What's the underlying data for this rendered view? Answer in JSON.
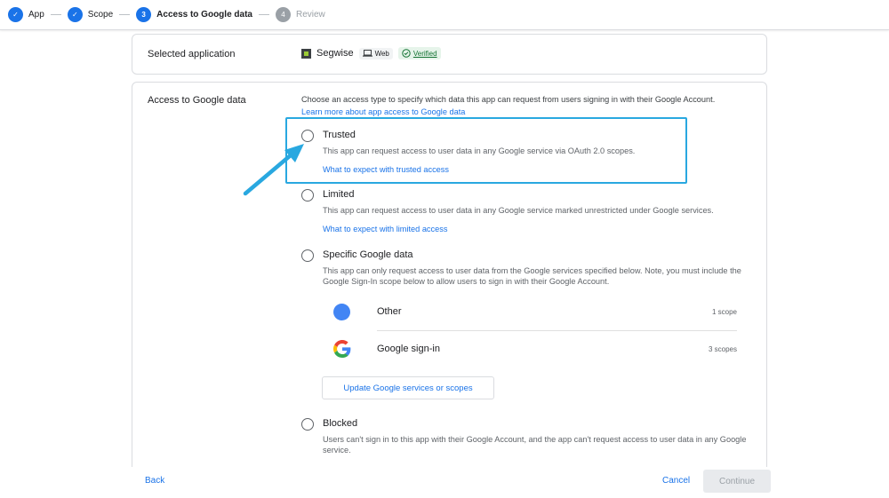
{
  "stepper": {
    "steps": [
      {
        "label": "App",
        "marker": "✓",
        "state": "done"
      },
      {
        "label": "Scope",
        "marker": "✓",
        "state": "done"
      },
      {
        "label": "Access to Google data",
        "marker": "3",
        "state": "current"
      },
      {
        "label": "Review",
        "marker": "4",
        "state": "pending"
      }
    ]
  },
  "selected_app": {
    "label": "Selected application",
    "app_name": "Segwise",
    "platform_chip": "Web",
    "verified_chip": "Verified"
  },
  "access": {
    "label": "Access to Google data",
    "intro": "Choose an access type to specify which data this app can request from users signing in with their Google Account.",
    "learn_more": "Learn more about app access to Google data",
    "options": {
      "trusted": {
        "title": "Trusted",
        "description": "This app can request access to user data in any Google service via OAuth 2.0 scopes.",
        "link": "What to expect with trusted access"
      },
      "limited": {
        "title": "Limited",
        "description": "This app can request access to user data in any Google service marked unrestricted under Google services.",
        "link": "What to expect with limited access"
      },
      "specific": {
        "title": "Specific Google data",
        "description": "This app can only request access to user data from the Google services specified below. Note, you must include the Google Sign-In scope below to allow users to sign in with their Google Account."
      },
      "blocked": {
        "title": "Blocked",
        "description": "Users can't sign in to this app with their Google Account, and the app can't request access to user data in any Google service."
      }
    },
    "services": [
      {
        "name": "Other",
        "count": "1 scope",
        "icon": "blue-dot-icon"
      },
      {
        "name": "Google sign-in",
        "count": "3 scopes",
        "icon": "google-g-icon"
      }
    ],
    "update_button": "Update Google services or scopes"
  },
  "footer": {
    "back": "Back",
    "cancel": "Cancel",
    "continue": "Continue"
  },
  "colors": {
    "accent": "#1a73e8",
    "highlight": "#29a8e0",
    "verified": "#137333"
  }
}
